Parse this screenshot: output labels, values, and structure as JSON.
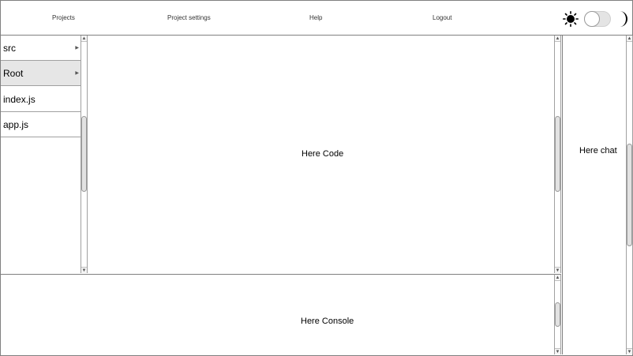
{
  "nav": {
    "links": [
      "Projects",
      "Project settings",
      "Help",
      "Logout"
    ]
  },
  "theme_toggle": {
    "light_icon": "sun-icon",
    "dark_icon": "moon-icon",
    "state": "light"
  },
  "file_tree": {
    "items": [
      {
        "label": "src",
        "has_children": true
      },
      {
        "label": "Root",
        "has_children": true,
        "selected": true
      },
      {
        "label": "index.js",
        "has_children": false
      },
      {
        "label": "app.js",
        "has_children": false
      }
    ]
  },
  "code": {
    "placeholder": "Here Code"
  },
  "console": {
    "placeholder": "Here Console"
  },
  "chat": {
    "placeholder": "Here chat"
  },
  "colors": {
    "border": "#808080",
    "selected_bg": "#e6e6e6",
    "toggle_track": "#e4e4e4"
  }
}
